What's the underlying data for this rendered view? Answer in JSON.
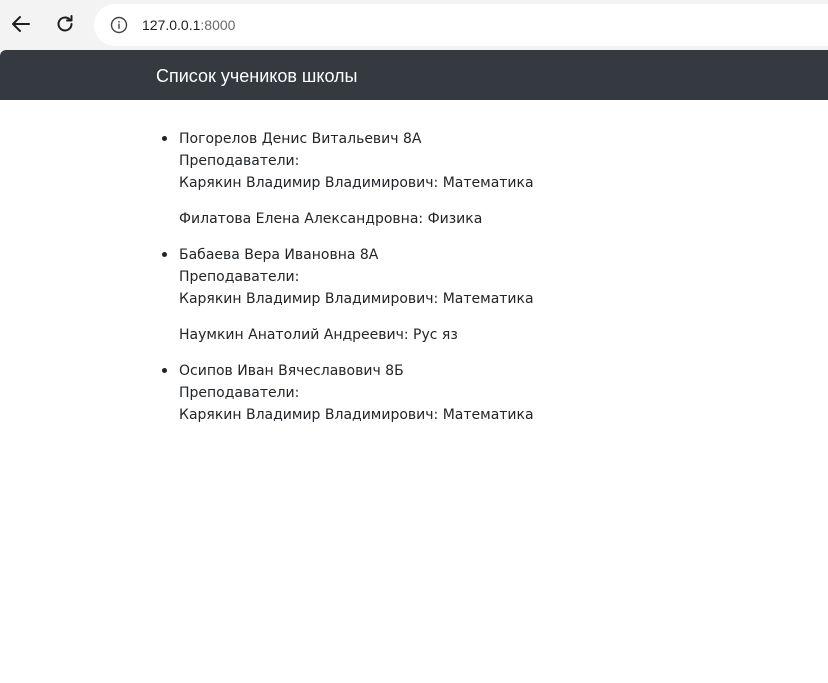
{
  "browser": {
    "url_host": "127.0.0.1",
    "url_port": ":8000"
  },
  "header": {
    "title": "Список учеников школы"
  },
  "students": [
    {
      "name": "Погорелов Денис Витальевич 8А",
      "teachers_label": "Преподаватели:",
      "teachers": [
        "Карякин Владимир Владимирович: Математика",
        "Филатова Елена Александровна: Физика"
      ]
    },
    {
      "name": "Бабаева Вера Ивановна 8А",
      "teachers_label": "Преподаватели:",
      "teachers": [
        "Карякин Владимир Владимирович: Математика",
        "Наумкин Анатолий Андреевич: Рус яз"
      ]
    },
    {
      "name": "Осипов Иван Вячеславович 8Б",
      "teachers_label": "Преподаватели:",
      "teachers": [
        "Карякин Владимир Владимирович: Математика"
      ]
    }
  ]
}
